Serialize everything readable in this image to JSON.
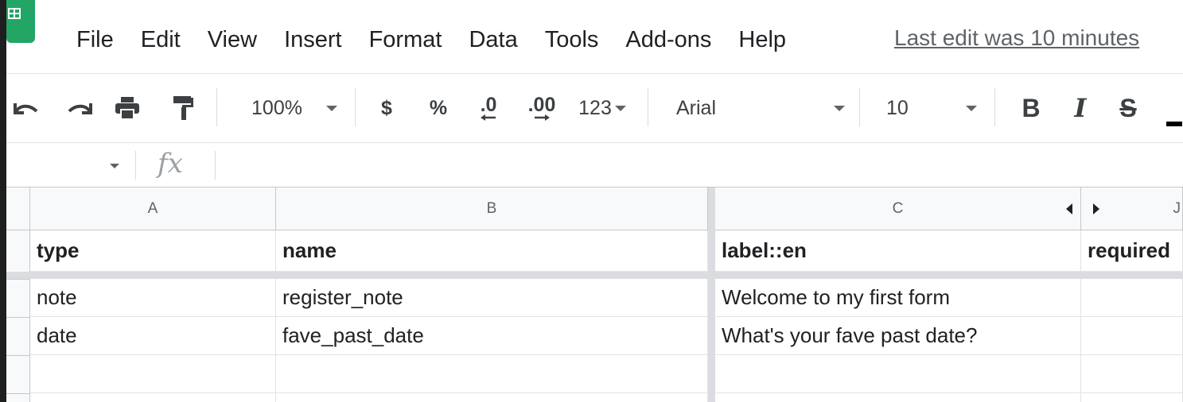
{
  "menu": {
    "items": [
      "File",
      "Edit",
      "View",
      "Insert",
      "Format",
      "Data",
      "Tools",
      "Add-ons",
      "Help"
    ],
    "last_edit": "Last edit was 10 minutes"
  },
  "toolbar": {
    "zoom": "100%",
    "currency": "$",
    "percent": "%",
    "decrease_decimal": ".0",
    "increase_decimal": ".00",
    "number_format": "123",
    "font": "Arial",
    "font_size": "10",
    "bold": "B",
    "italic": "I",
    "strike": "S"
  },
  "formula_bar": {
    "fx": "fx",
    "value": ""
  },
  "sheet": {
    "columns": [
      "A",
      "B",
      "C",
      "J"
    ],
    "rows": [
      [
        "type",
        "name",
        "label::en",
        "required"
      ],
      [
        "note",
        "register_note",
        "Welcome to my first form",
        ""
      ],
      [
        "date",
        "fave_past_date",
        "What's your fave past date?",
        ""
      ],
      [
        "",
        "",
        "",
        ""
      ],
      [
        "",
        "",
        "",
        ""
      ]
    ]
  },
  "colors": {
    "brand": "#23a566",
    "header_bg": "#f8f9fa",
    "freeze": "#dadce0"
  }
}
